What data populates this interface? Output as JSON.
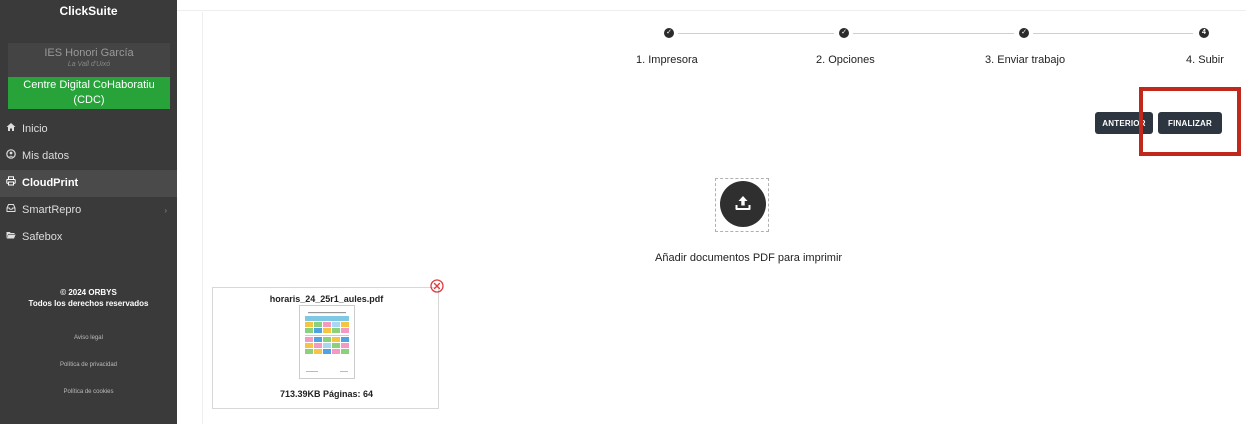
{
  "sidebar": {
    "brand": "ClickSuite",
    "school_name": "IES Honori García",
    "school_town": "La Vall d'Uixó",
    "center_badge": "Centre Digital CoHaboratiu (CDC)",
    "nav": [
      {
        "label": "Inicio",
        "icon": "home-icon"
      },
      {
        "label": "Mis datos",
        "icon": "user-icon"
      },
      {
        "label": "CloudPrint",
        "icon": "printer-icon",
        "active": true
      },
      {
        "label": "SmartRepro",
        "icon": "inbox-icon",
        "has_submenu": true
      },
      {
        "label": "Safebox",
        "icon": "folder-icon"
      }
    ],
    "copyright": "© 2024 ORBYS",
    "rights": "Todos los derechos reservados",
    "links": [
      "Aviso legal",
      "Política de privacidad",
      "Política de cookies"
    ]
  },
  "stepper": {
    "steps": [
      {
        "label": "1. Impresora",
        "state": "done",
        "marker": "✓"
      },
      {
        "label": "2. Opciones",
        "state": "done",
        "marker": "✓"
      },
      {
        "label": "3. Enviar trabajo",
        "state": "done",
        "marker": "✓"
      },
      {
        "label": "4. Subir",
        "state": "current",
        "marker": "4"
      }
    ]
  },
  "actions": {
    "previous_label": "ANTERIOR",
    "finish_label": "FINALIZAR"
  },
  "upload": {
    "label": "Añadir documentos PDF para imprimir"
  },
  "file": {
    "name": "horaris_24_25r1_aules.pdf",
    "meta": "713.39KB Páginas: 64"
  },
  "colors": {
    "sidebar_bg": "#3a3a3a",
    "badge_green": "#27a33a",
    "button_dark": "#2d3640",
    "highlight_red": "#c0281c",
    "remove_red": "#e0393e"
  }
}
